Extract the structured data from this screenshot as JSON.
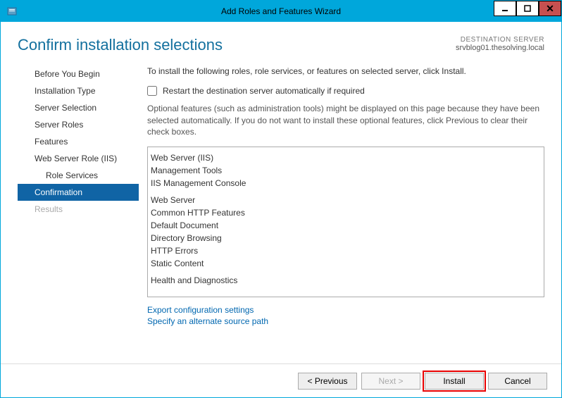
{
  "titlebar": {
    "title": "Add Roles and Features Wizard"
  },
  "header": {
    "page_title": "Confirm installation selections",
    "dest_label": "DESTINATION SERVER",
    "dest_server": "srvblog01.thesolving.local"
  },
  "nav": {
    "before": "Before You Begin",
    "install_type": "Installation Type",
    "server_sel": "Server Selection",
    "server_roles": "Server Roles",
    "features": "Features",
    "web_role": "Web Server Role (IIS)",
    "role_services": "Role Services",
    "confirmation": "Confirmation",
    "results": "Results"
  },
  "main": {
    "instruction": "To install the following roles, role services, or features on selected server, click Install.",
    "restart_label": "Restart the destination server automatically if required",
    "optional_note": "Optional features (such as administration tools) might be displayed on this page because they have been selected automatically. If you do not want to install these optional features, click Previous to clear their check boxes.",
    "tree": {
      "web_iis": "Web Server (IIS)",
      "mgmt_tools": "Management Tools",
      "iis_console": "IIS Management Console",
      "web_server": "Web Server",
      "common_http": "Common HTTP Features",
      "default_doc": "Default Document",
      "dir_browsing": "Directory Browsing",
      "http_errors": "HTTP Errors",
      "static_content": "Static Content",
      "health_diag": "Health and Diagnostics"
    },
    "link_export": "Export configuration settings",
    "link_source": "Specify an alternate source path"
  },
  "footer": {
    "previous": "< Previous",
    "next": "Next >",
    "install": "Install",
    "cancel": "Cancel"
  }
}
